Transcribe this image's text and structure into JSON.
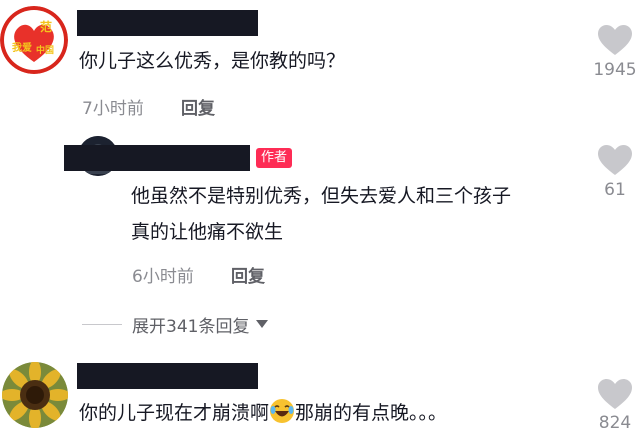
{
  "comments": [
    {
      "avatar_icon": "flower-heart-badge-avatar",
      "text": "你儿子这么优秀，是你教的吗？",
      "time": "7小时前",
      "reply_label": "回复",
      "likes": "1945"
    },
    {
      "avatar_icon": "dark-avatar",
      "author_tag": "作者",
      "text_line1": "他虽然不是特别优秀，但失去爱人和三个孩子",
      "text_line2": "真的让他痛不欲生",
      "time": "6小时前",
      "reply_label": "回复",
      "likes": "61"
    },
    {
      "avatar_icon": "sunflower-avatar",
      "text_before": "你的儿子现在才崩溃啊",
      "emoji_icon": "crying-laughing-emoji",
      "text_after": "那崩的有点晚。。。",
      "likes": "824"
    }
  ],
  "expand_replies": {
    "label": "展开341条回复",
    "icon": "caret-down-icon"
  },
  "colors": {
    "text": "#161823",
    "meta": "#8a8b91",
    "author_tag": "#fe2c55",
    "heart": "#c8c8cc",
    "name_mask": "#161823"
  }
}
